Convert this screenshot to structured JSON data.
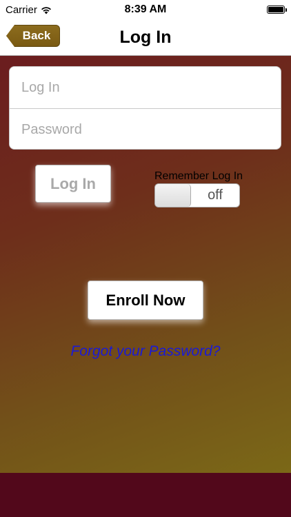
{
  "status_bar": {
    "carrier": "Carrier",
    "time": "8:39 AM"
  },
  "nav": {
    "back_label": "Back",
    "title": "Log In"
  },
  "form": {
    "login_placeholder": "Log In",
    "password_placeholder": "Password"
  },
  "login_button_label": "Log In",
  "remember": {
    "label": "Remember Log In",
    "state": "off"
  },
  "enroll_button_label": "Enroll Now",
  "forgot_link": "Forgot your Password?",
  "colors": {
    "nav_accent": "#7a5a12",
    "link": "#1a1ad6",
    "bottom_bar": "#52081b"
  },
  "icons": {
    "wifi": "wifi-icon",
    "battery": "battery-icon"
  }
}
